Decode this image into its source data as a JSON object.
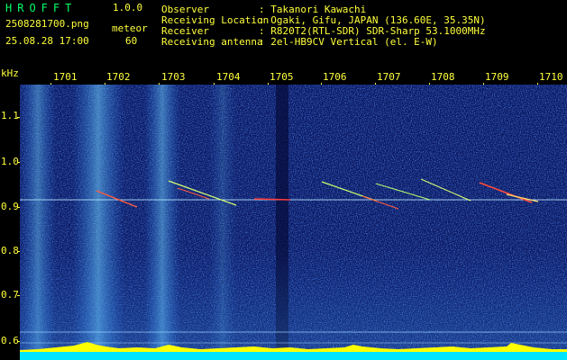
{
  "header": {
    "app_name": "HROFFT",
    "version": "1.0.0",
    "filename": "2508281700.png",
    "datetime": "25.08.28 17:00",
    "meteor_label": "meteor",
    "meteor_count": "60",
    "info_rows": [
      {
        "label": "Observer",
        "value": ": Takanori Kawachi"
      },
      {
        "label": "Receiving Location",
        "value": ": Ogaki, Gifu, JAPAN (136.60E, 35.35N)"
      },
      {
        "label": "Receiver",
        "value": ": R820T2(RTL-SDR) SDR-Sharp 53.1000MHz"
      },
      {
        "label": "Receiving antenna",
        "value": ": 2el-HB9CV Vertical (el. E-W)"
      }
    ]
  },
  "axes": {
    "y_unit": "kHz",
    "x_ticks": [
      "1701",
      "1702",
      "1703",
      "1704",
      "1705",
      "1706",
      "1707",
      "1708",
      "1709",
      "1710"
    ],
    "y_ticks": [
      "1.1",
      "1.0",
      "0.9",
      "0.8",
      "0.7",
      "0.6"
    ]
  },
  "colors": {
    "background": "#0b1a6e",
    "signal": "#ff3030",
    "noise": "#2a6cff",
    "level_bar": "#ffff00",
    "baseline": "#00e5ff"
  }
}
